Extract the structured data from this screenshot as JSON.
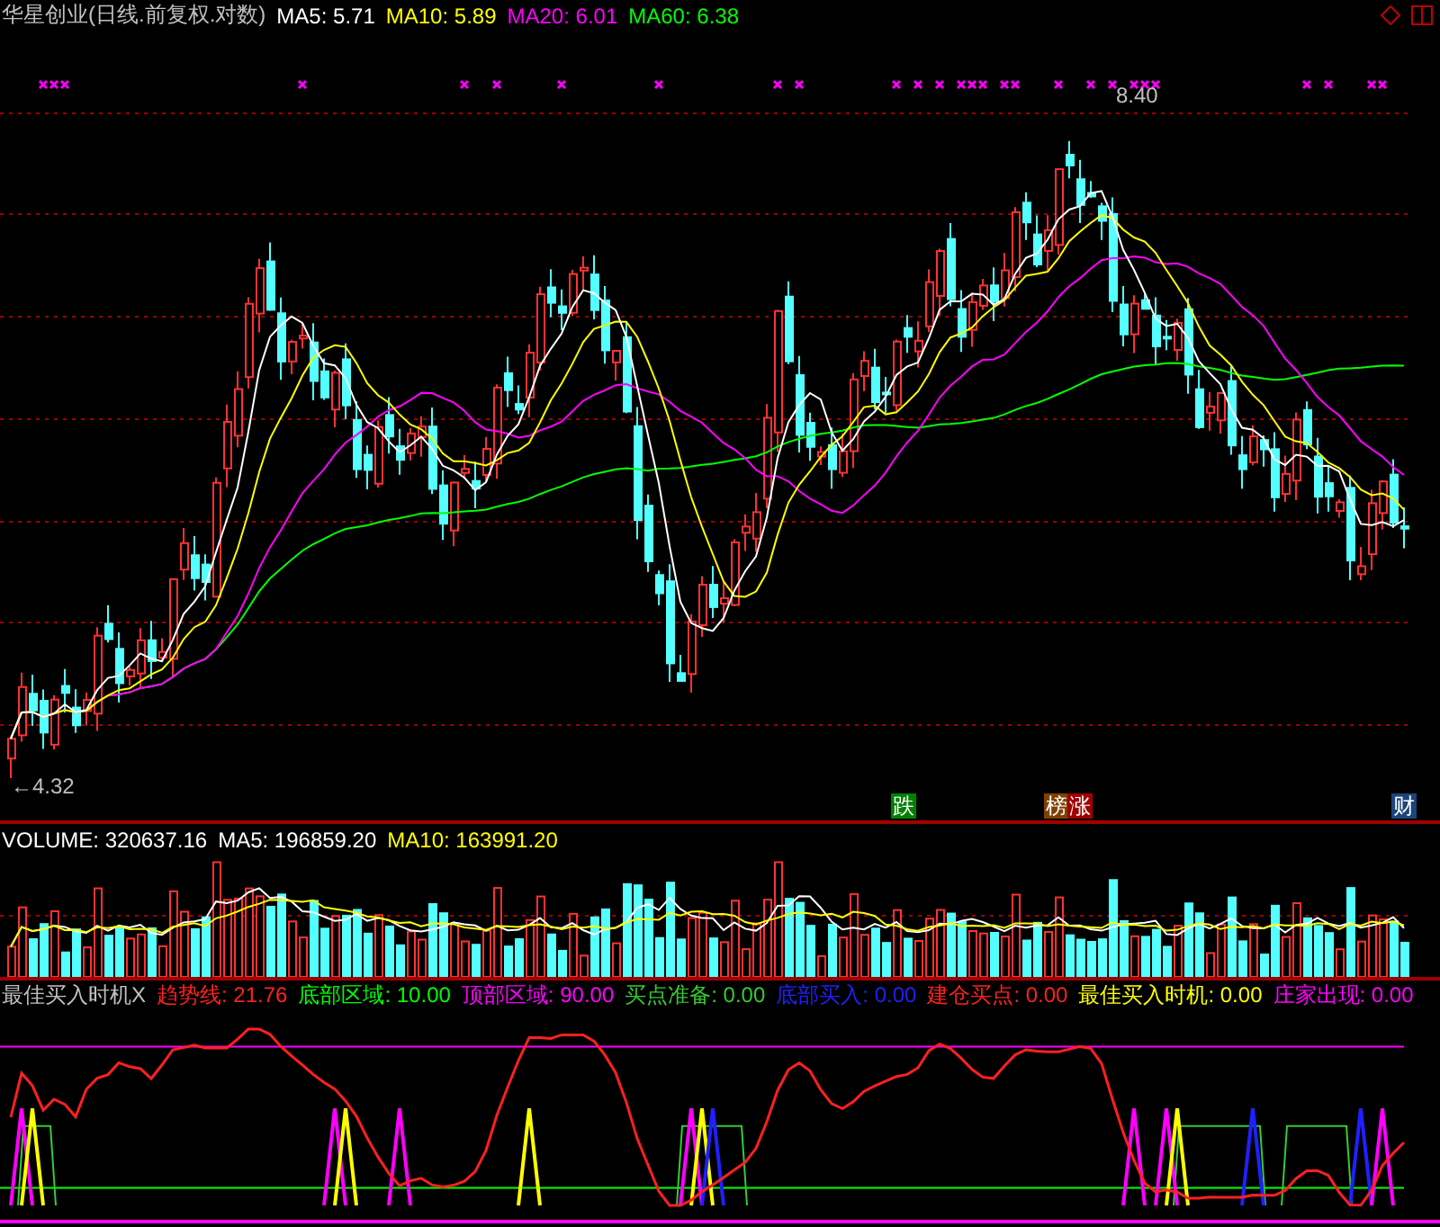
{
  "title": "华星创业(日线.前复权.对数)",
  "price_ma": [
    {
      "text": "MA5: 5.71",
      "color": "#ffffff"
    },
    {
      "text": "MA10: 5.89",
      "color": "#ffff00"
    },
    {
      "text": "MA20: 6.01",
      "color": "#ff00ff"
    },
    {
      "text": "MA60: 6.38",
      "color": "#00ff00"
    }
  ],
  "high_label": "8.40",
  "low_label": "←4.32",
  "badges": [
    {
      "text": "跌",
      "color": "#008000"
    },
    {
      "text": "榜",
      "color": "#804000"
    },
    {
      "text": "涨",
      "color": "#a00000"
    },
    {
      "text": "财",
      "color": "#1c4478"
    }
  ],
  "volume_items": [
    {
      "text": "VOLUME: 320637.16",
      "color": "#ffffff"
    },
    {
      "text": "MA5: 196859.20",
      "color": "#ffffff"
    },
    {
      "text": "MA10: 163991.20",
      "color": "#ffff00"
    }
  ],
  "indicator_items": [
    {
      "text": "最佳买入时机X",
      "color": "#c0c0c0"
    },
    {
      "text": "趋势线: 21.76",
      "color": "#ff2020"
    },
    {
      "text": "底部区域: 10.00",
      "color": "#00ff00"
    },
    {
      "text": "顶部区域: 90.00",
      "color": "#ff00ff"
    },
    {
      "text": "买点准备: 0.00",
      "color": "#33cc33"
    },
    {
      "text": "底部买入: 0.00",
      "color": "#2020ff"
    },
    {
      "text": "建仓买点: 0.00",
      "color": "#ff2020"
    },
    {
      "text": "最佳买入时机: 0.00",
      "color": "#ffff00"
    },
    {
      "text": "庄家出现: 0.00",
      "color": "#ff00ff"
    }
  ]
}
